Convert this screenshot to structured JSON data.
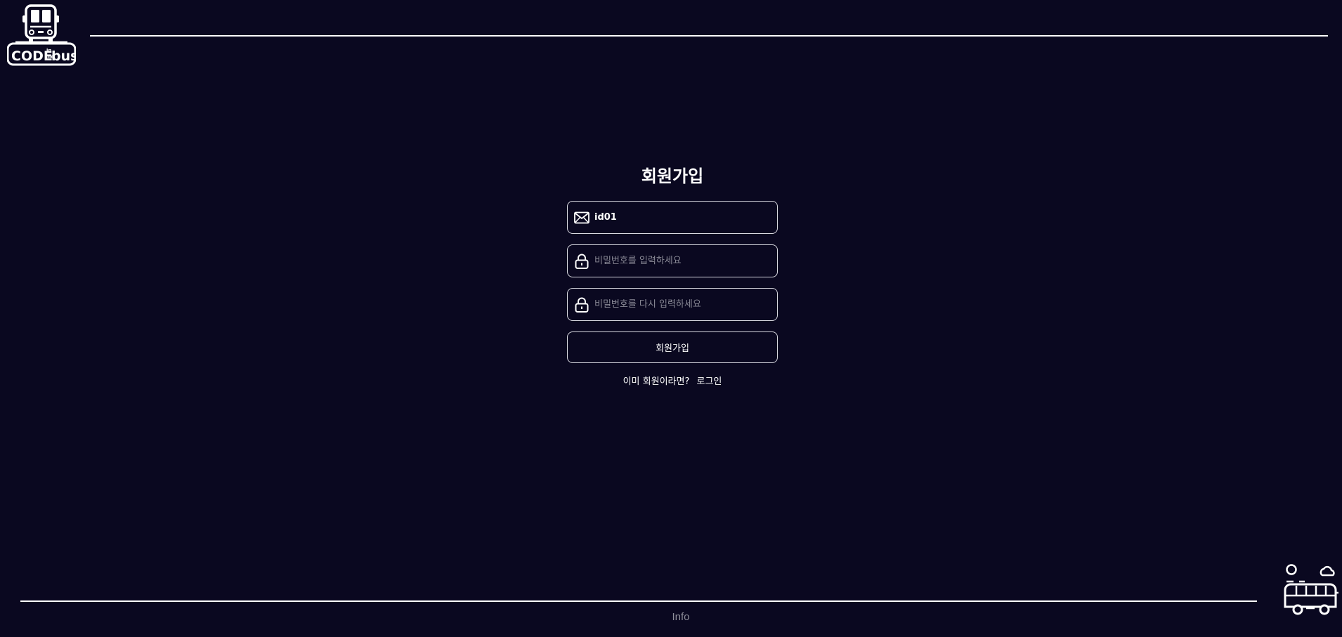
{
  "header": {
    "logo_text_main": "CODE",
    "logo_text_in": "in",
    "logo_text_the": "the",
    "logo_text_bus": "bus"
  },
  "signup": {
    "title": "회원가입",
    "id_field": {
      "value": "id01",
      "icon": "mail-icon"
    },
    "password_field": {
      "placeholder": "비밀번호를 입력하세요",
      "icon": "lock-icon"
    },
    "password_confirm_field": {
      "placeholder": "비밀번호를 다시 입력하세요",
      "icon": "lock-icon"
    },
    "submit_label": "회원가입",
    "login_prompt": "이미 회원이라면?",
    "login_link": "로그인"
  },
  "footer": {
    "info": "Info"
  },
  "colors": {
    "background": "#0a0820",
    "text": "#ffffff",
    "border": "#d8d8e0",
    "muted": "#8f8f9a"
  }
}
